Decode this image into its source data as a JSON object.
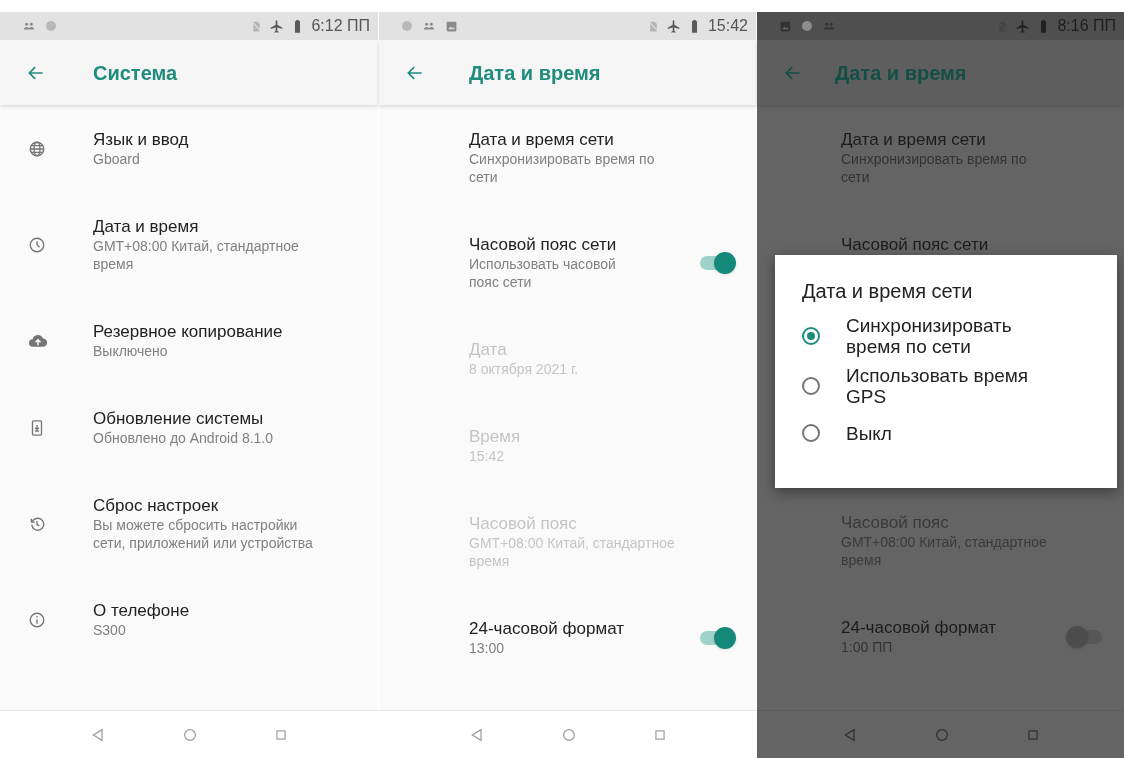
{
  "screens": [
    {
      "dimmed": false,
      "status_time": "6:12 ПП",
      "title": "Система",
      "items": [
        {
          "title": "Язык и ввод",
          "subtitle": "Gboard",
          "disabled": false,
          "kind": "plain"
        },
        {
          "title": "Дата и время",
          "subtitle": "GMT+08:00 Китай, стандартное время",
          "disabled": false,
          "kind": "plain"
        },
        {
          "title": "Резервное копирование",
          "subtitle": "Выключено",
          "disabled": false,
          "kind": "plain"
        },
        {
          "title": "Обновление системы",
          "subtitle": "Обновлено до Android 8.1.0",
          "disabled": false,
          "kind": "plain"
        },
        {
          "title": "Сброс настроек",
          "subtitle": "Вы можете сбросить настройки сети, приложений или устройства",
          "disabled": false,
          "kind": "plain"
        },
        {
          "title": "О телефоне",
          "subtitle": "S300",
          "disabled": false,
          "kind": "plain"
        }
      ]
    },
    {
      "dimmed": false,
      "status_time": "15:42",
      "title": "Дата и время",
      "items": [
        {
          "title": "Дата и время сети",
          "subtitle": "Синхронизировать время по сети",
          "disabled": false,
          "kind": "plain"
        },
        {
          "title": "Часовой пояс сети",
          "subtitle": "Использовать часовой пояс сети",
          "disabled": false,
          "kind": "switch",
          "on": true
        },
        {
          "title": "Дата",
          "subtitle": "8 октября 2021 г.",
          "disabled": true,
          "kind": "plain"
        },
        {
          "title": "Время",
          "subtitle": "15:42",
          "disabled": true,
          "kind": "plain"
        },
        {
          "title": "Часовой пояс",
          "subtitle": "GMT+08:00 Китай, стандартное время",
          "disabled": true,
          "kind": "plain"
        },
        {
          "title": "24-часовой формат",
          "subtitle": "13:00",
          "disabled": false,
          "kind": "switch",
          "on": true
        }
      ]
    },
    {
      "dimmed": true,
      "status_time": "8:16 ПП",
      "title": "Дата и время",
      "items": [
        {
          "title": "Дата и время сети",
          "subtitle": "Синхронизировать время по сети",
          "disabled": false,
          "kind": "plain"
        },
        {
          "title": "Часовой пояс сети",
          "disabled": false,
          "kind": "plain"
        }
      ],
      "dialog": {
        "title": "Дата и время сети",
        "options": [
          {
            "label": "Синхронизировать время по сети",
            "selected": true
          },
          {
            "label": "Использовать время GPS",
            "selected": false
          },
          {
            "label": "Выкл",
            "selected": false
          }
        ]
      },
      "lower_items": [
        {
          "title": "Часовой пояс",
          "subtitle": "GMT+08:00 Китай, стандартное время",
          "disabled": true,
          "kind": "plain"
        },
        {
          "title": "24-часовой формат",
          "subtitle": "1:00 ПП",
          "disabled": false,
          "kind": "switch",
          "on": false
        }
      ]
    }
  ]
}
